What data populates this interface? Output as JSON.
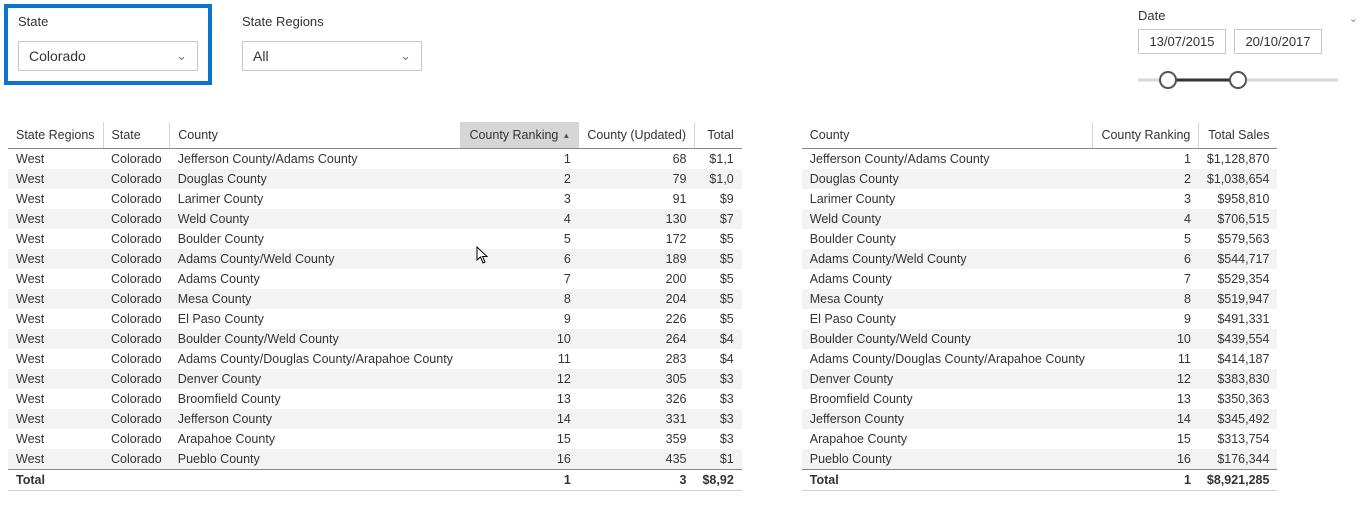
{
  "filters": {
    "state": {
      "label": "State",
      "value": "Colorado"
    },
    "region": {
      "label": "State Regions",
      "value": "All"
    }
  },
  "dateFilter": {
    "label": "Date",
    "from": "13/07/2015",
    "to": "20/10/2017"
  },
  "table1": {
    "headers": {
      "region": "State Regions",
      "state": "State",
      "county": "County",
      "ranking": "County Ranking",
      "updated": "County (Updated)",
      "total": "Total"
    },
    "rows": [
      {
        "region": "West",
        "state": "Colorado",
        "county": "Jefferson County/Adams County",
        "ranking": "1",
        "updated": "68",
        "total": "$1,1"
      },
      {
        "region": "West",
        "state": "Colorado",
        "county": "Douglas County",
        "ranking": "2",
        "updated": "79",
        "total": "$1,0"
      },
      {
        "region": "West",
        "state": "Colorado",
        "county": "Larimer County",
        "ranking": "3",
        "updated": "91",
        "total": "$9"
      },
      {
        "region": "West",
        "state": "Colorado",
        "county": "Weld County",
        "ranking": "4",
        "updated": "130",
        "total": "$7"
      },
      {
        "region": "West",
        "state": "Colorado",
        "county": "Boulder County",
        "ranking": "5",
        "updated": "172",
        "total": "$5"
      },
      {
        "region": "West",
        "state": "Colorado",
        "county": "Adams County/Weld County",
        "ranking": "6",
        "updated": "189",
        "total": "$5"
      },
      {
        "region": "West",
        "state": "Colorado",
        "county": "Adams County",
        "ranking": "7",
        "updated": "200",
        "total": "$5"
      },
      {
        "region": "West",
        "state": "Colorado",
        "county": "Mesa County",
        "ranking": "8",
        "updated": "204",
        "total": "$5"
      },
      {
        "region": "West",
        "state": "Colorado",
        "county": "El Paso County",
        "ranking": "9",
        "updated": "226",
        "total": "$5"
      },
      {
        "region": "West",
        "state": "Colorado",
        "county": "Boulder County/Weld County",
        "ranking": "10",
        "updated": "264",
        "total": "$4"
      },
      {
        "region": "West",
        "state": "Colorado",
        "county": "Adams County/Douglas County/Arapahoe County",
        "ranking": "11",
        "updated": "283",
        "total": "$4"
      },
      {
        "region": "West",
        "state": "Colorado",
        "county": "Denver County",
        "ranking": "12",
        "updated": "305",
        "total": "$3"
      },
      {
        "region": "West",
        "state": "Colorado",
        "county": "Broomfield County",
        "ranking": "13",
        "updated": "326",
        "total": "$3"
      },
      {
        "region": "West",
        "state": "Colorado",
        "county": "Jefferson County",
        "ranking": "14",
        "updated": "331",
        "total": "$3"
      },
      {
        "region": "West",
        "state": "Colorado",
        "county": "Arapahoe County",
        "ranking": "15",
        "updated": "359",
        "total": "$3"
      },
      {
        "region": "West",
        "state": "Colorado",
        "county": "Pueblo County",
        "ranking": "16",
        "updated": "435",
        "total": "$1"
      }
    ],
    "totalRow": {
      "label": "Total",
      "ranking": "1",
      "updated": "3",
      "total": "$8,92"
    }
  },
  "table2": {
    "headers": {
      "county": "County",
      "ranking": "County Ranking",
      "totalSales": "Total Sales"
    },
    "rows": [
      {
        "county": "Jefferson County/Adams County",
        "ranking": "1",
        "totalSales": "$1,128,870"
      },
      {
        "county": "Douglas County",
        "ranking": "2",
        "totalSales": "$1,038,654"
      },
      {
        "county": "Larimer County",
        "ranking": "3",
        "totalSales": "$958,810"
      },
      {
        "county": "Weld County",
        "ranking": "4",
        "totalSales": "$706,515"
      },
      {
        "county": "Boulder County",
        "ranking": "5",
        "totalSales": "$579,563"
      },
      {
        "county": "Adams County/Weld County",
        "ranking": "6",
        "totalSales": "$544,717"
      },
      {
        "county": "Adams County",
        "ranking": "7",
        "totalSales": "$529,354"
      },
      {
        "county": "Mesa County",
        "ranking": "8",
        "totalSales": "$519,947"
      },
      {
        "county": "El Paso County",
        "ranking": "9",
        "totalSales": "$491,331"
      },
      {
        "county": "Boulder County/Weld County",
        "ranking": "10",
        "totalSales": "$439,554"
      },
      {
        "county": "Adams County/Douglas County/Arapahoe County",
        "ranking": "11",
        "totalSales": "$414,187"
      },
      {
        "county": "Denver County",
        "ranking": "12",
        "totalSales": "$383,830"
      },
      {
        "county": "Broomfield County",
        "ranking": "13",
        "totalSales": "$350,363"
      },
      {
        "county": "Jefferson County",
        "ranking": "14",
        "totalSales": "$345,492"
      },
      {
        "county": "Arapahoe County",
        "ranking": "15",
        "totalSales": "$313,754"
      },
      {
        "county": "Pueblo County",
        "ranking": "16",
        "totalSales": "$176,344"
      }
    ],
    "totalRow": {
      "label": "Total",
      "ranking": "1",
      "totalSales": "$8,921,285"
    }
  }
}
